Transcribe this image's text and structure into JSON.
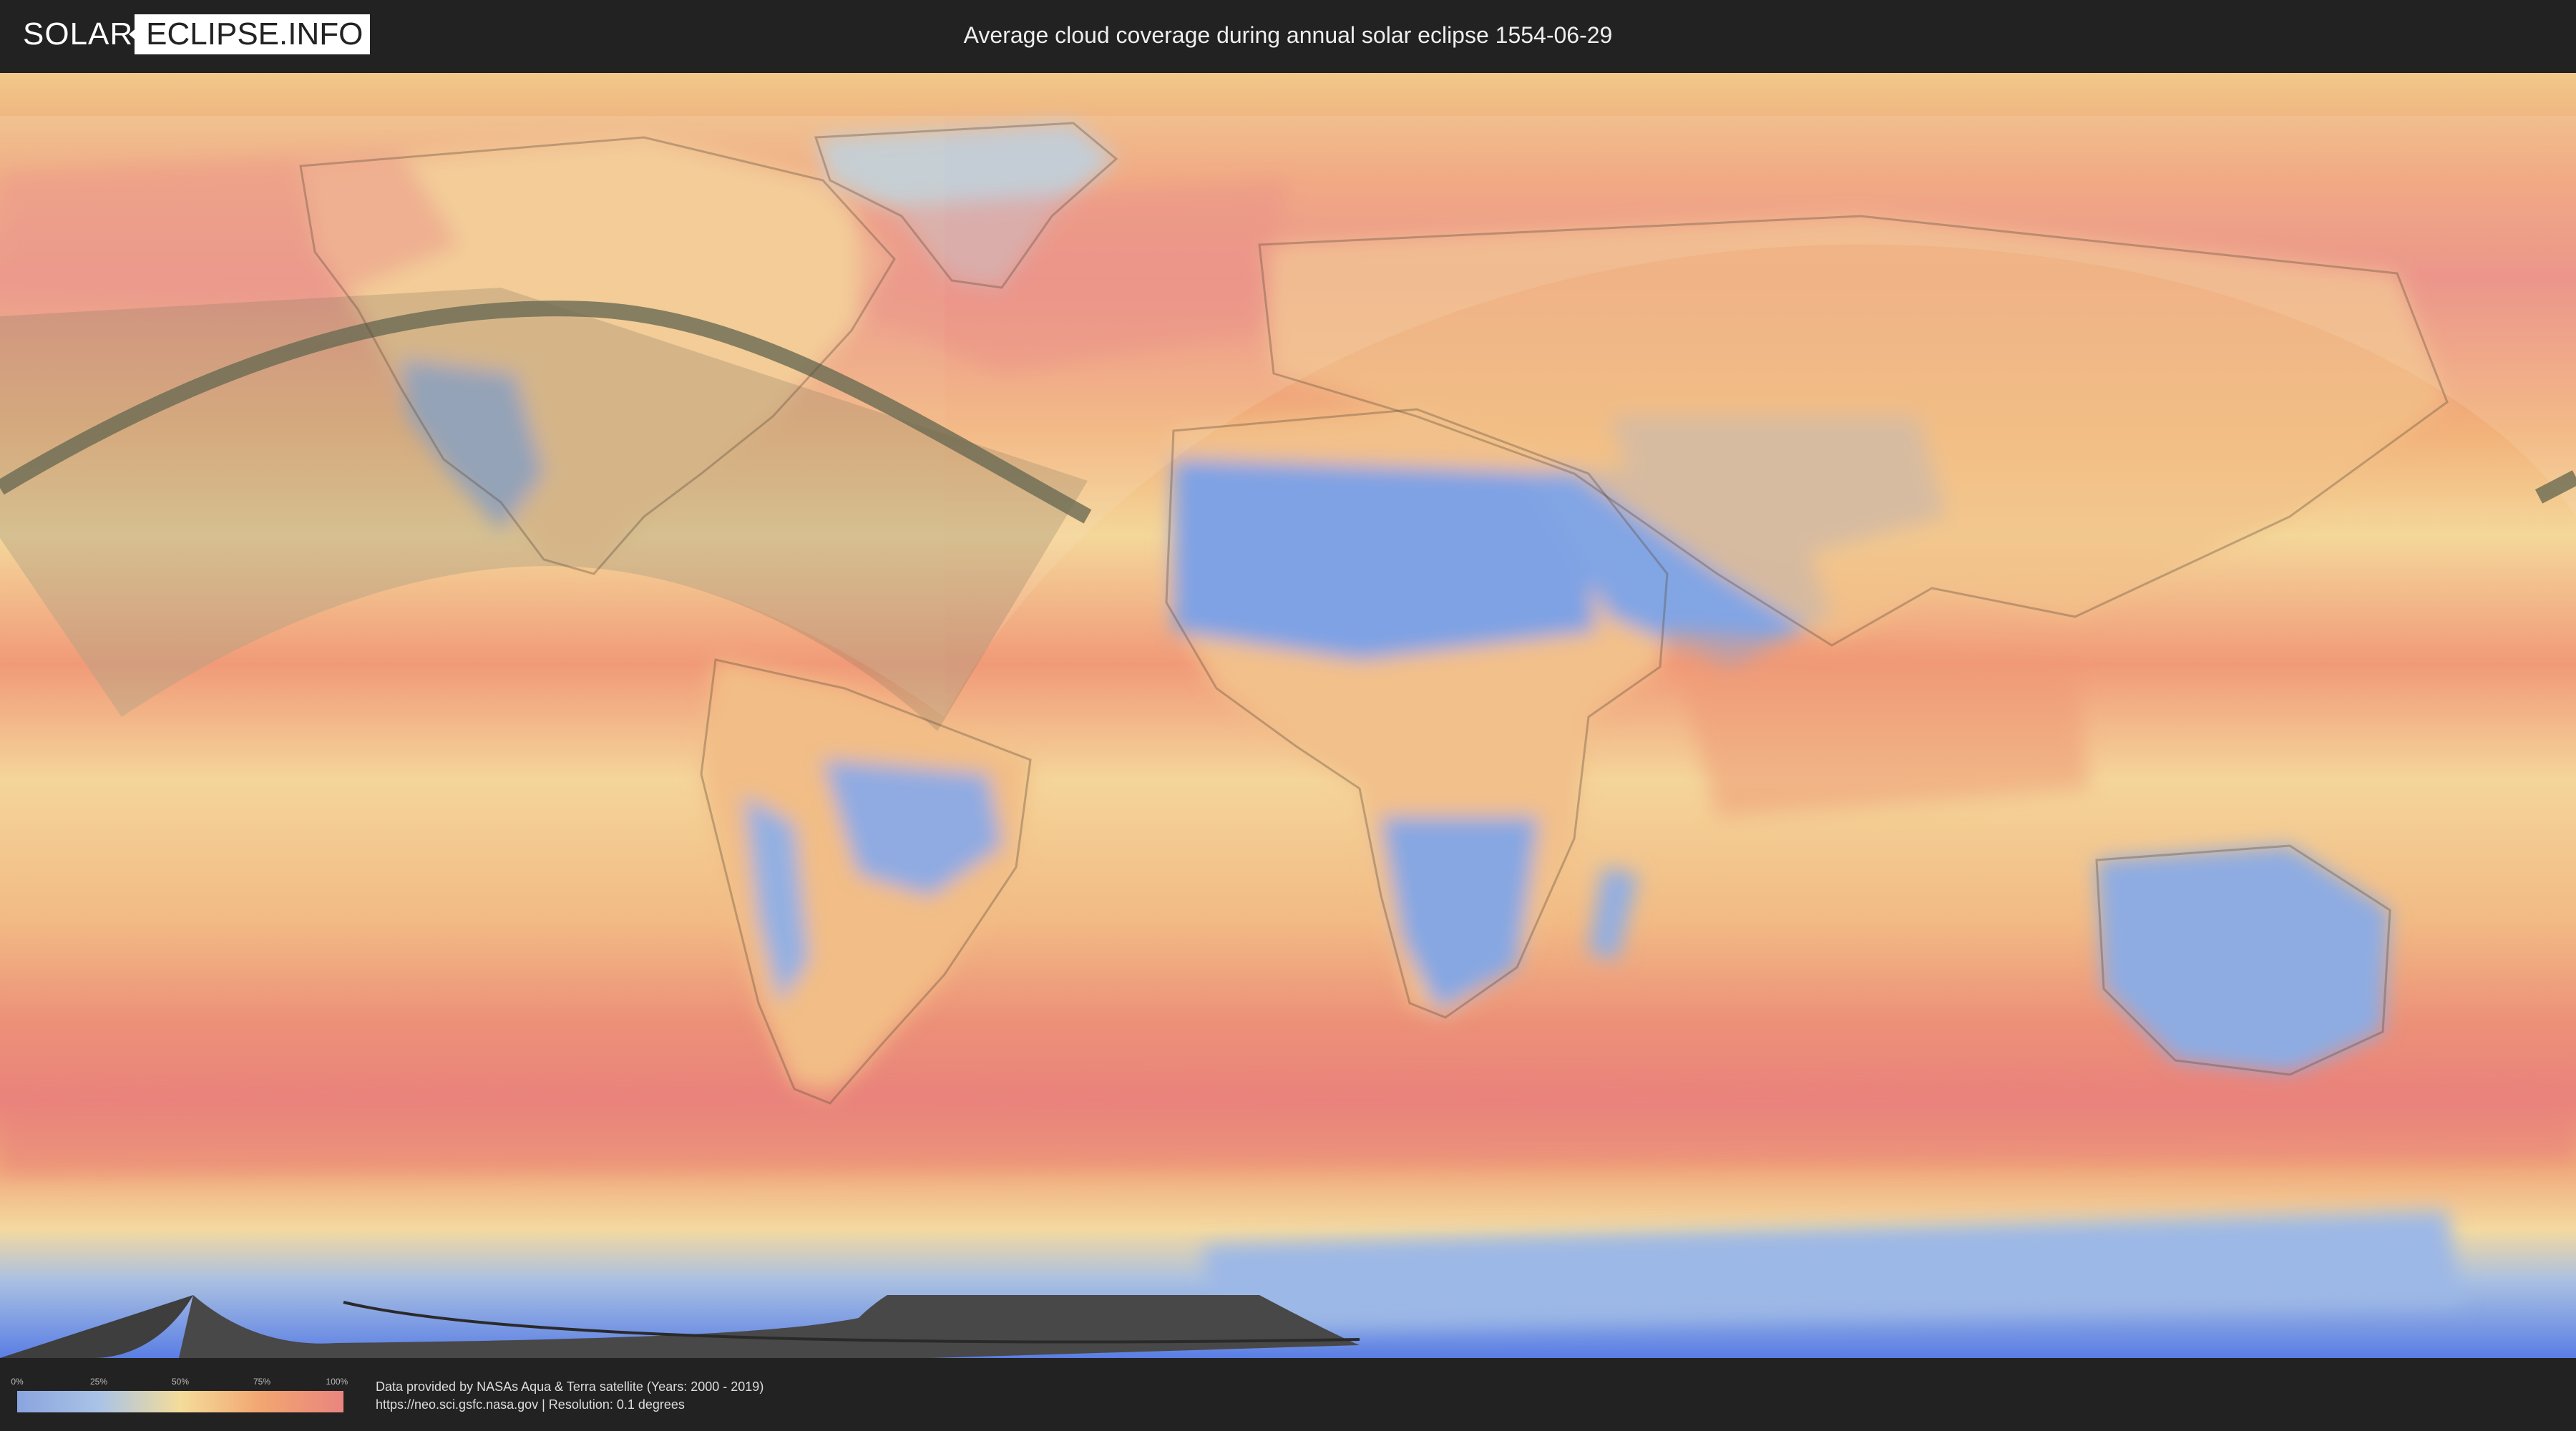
{
  "header": {
    "logo_solar": "SOLAR",
    "logo_eclipse": "ECLIPSE.INFO",
    "title": "Average cloud coverage during annual solar eclipse 1554-06-29"
  },
  "legend": {
    "ticks": [
      "0%",
      "25%",
      "50%",
      "75%",
      "100%"
    ]
  },
  "credits": {
    "line1": "Data provided by NASAs Aqua & Terra satellite (Years: 2000 - 2019)",
    "line2": "https://neo.sci.gsfc.nasa.gov | Resolution: 0.1 degrees"
  },
  "colors": {
    "clear": "#8aa4e0",
    "partly": "#f4dc9a",
    "cloudy": "#e9857e",
    "background": "#222222"
  }
}
